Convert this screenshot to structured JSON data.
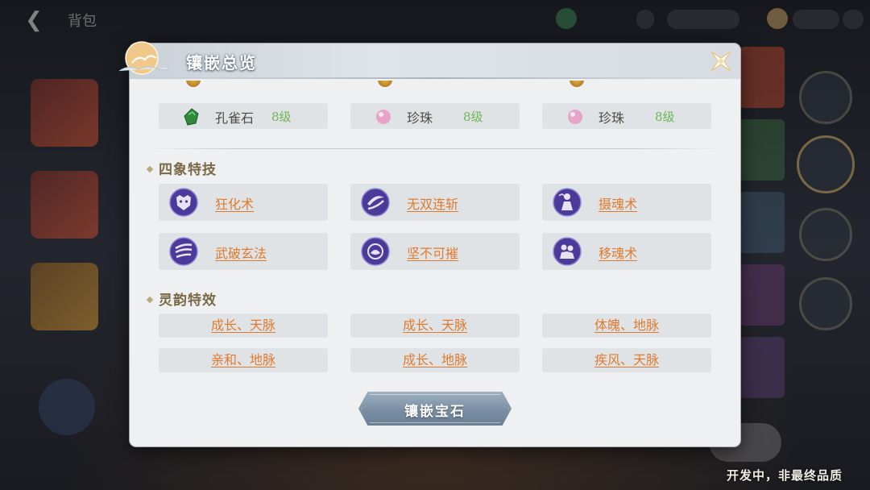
{
  "top_bar": {
    "title": "背包",
    "back_icon": "back-arrow-icon"
  },
  "watermark": "开发中，非最终品质",
  "dialog": {
    "title": "镶嵌总览",
    "close_icon": "close-icon",
    "gems": [
      {
        "name": "孔雀石",
        "level": "8级",
        "icon": "peacock-stone-gem-icon",
        "color": "#2f8a3c"
      },
      {
        "name": "珍珠",
        "level": "8级",
        "icon": "pearl-gem-icon",
        "color": "#e6a4c8"
      },
      {
        "name": "珍珠",
        "level": "8级",
        "icon": "pearl-gem-icon",
        "color": "#e6a4c8"
      }
    ],
    "skills_section": {
      "title": "四象特技",
      "items": [
        {
          "name": "狂化术",
          "icon": "tiger-head-icon"
        },
        {
          "name": "无双连斩",
          "icon": "crescent-slash-icon"
        },
        {
          "name": "摄魂术",
          "icon": "soul-capture-icon"
        },
        {
          "name": "武破玄法",
          "icon": "triple-slash-icon"
        },
        {
          "name": "坚不可摧",
          "icon": "shield-lotus-icon"
        },
        {
          "name": "移魂术",
          "icon": "soul-transfer-icon"
        }
      ]
    },
    "aura_section": {
      "title": "灵韵特效",
      "items": [
        "成长、天脉",
        "成长、天脉",
        "体魄、地脉",
        "亲和、地脉",
        "成长、地脉",
        "疾风、天脉"
      ]
    },
    "inlay_button": "镶嵌宝石"
  },
  "colors": {
    "link_orange": "#e07a2e",
    "level_green": "#6db45a",
    "section_brown": "#7a6845",
    "skill_icon_purple": "#4b3a9a"
  }
}
